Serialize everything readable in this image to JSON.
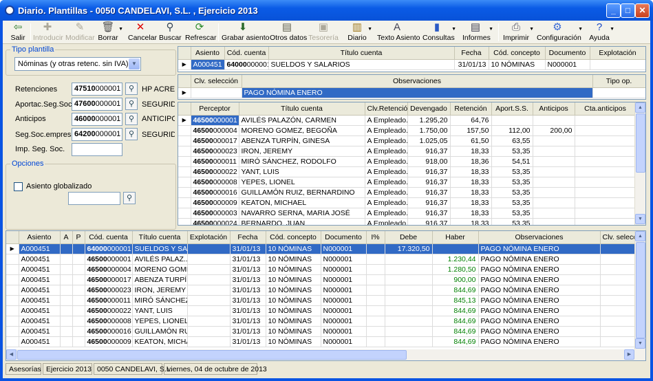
{
  "window": {
    "title": "Diario. Plantillas - 0050 CANDELAVI, S.L. , Ejercicio 2013"
  },
  "toolbar": {
    "salir": "Salir",
    "introducir": "Introducir",
    "modificar": "Modificar",
    "borrar": "Borrar",
    "cancelar": "Cancelar",
    "buscar": "Buscar",
    "refrescar": "Refrescar",
    "grabar_asiento": "Grabar asiento",
    "otros_datos": "Otros datos",
    "tesoreria": "Tesorería",
    "diario": "Diario",
    "texto_asiento": "Texto Asiento",
    "consultas": "Consultas",
    "informes": "Informes",
    "imprimir": "Imprimir",
    "configuracion": "Configuración",
    "ayuda": "Ayuda"
  },
  "left": {
    "tipo_title": "Tipo plantilla",
    "tipo_value": "Nóminas (y otras retenc. sin IVA)",
    "fields": [
      {
        "label": "Retenciones",
        "code_bold": "47510",
        "code": "000001",
        "desc": "HP ACREED"
      },
      {
        "label": "Aportac.Seg.Soc.",
        "code_bold": "47600",
        "code": "000001",
        "desc": "SEGURIDAI"
      },
      {
        "label": "Anticipos",
        "code_bold": "46000",
        "code": "000001",
        "desc": "ANTICIPOS"
      },
      {
        "label": "Seg.Soc.empresa",
        "code_bold": "64200",
        "code": "000001",
        "desc": "SEGURIDAI"
      },
      {
        "label": "Imp. Seg. Soc.",
        "code_bold": "",
        "code": "",
        "desc": ""
      }
    ],
    "opciones_title": "Opciones",
    "globalizado_label": "Asiento globalizado",
    "globalizado_value": ""
  },
  "header_grid": {
    "columns": [
      "Asiento",
      "Cód. cuenta",
      "Título cuenta",
      "Fecha",
      "Cód. concepto",
      "Documento",
      "Explotación"
    ],
    "row": {
      "asiento": "A000451",
      "cod_bold": "64000",
      "cod": "000001",
      "titulo": "SUELDOS Y SALARIOS",
      "fecha": "31/01/13",
      "concepto": "10 NÓMINAS",
      "documento": "N000001",
      "explotacion": ""
    }
  },
  "obs_grid": {
    "columns": [
      "Clv. selección",
      "Observaciones",
      "Tipo op."
    ],
    "row": {
      "clv": "",
      "obs": "PAGO NÓMINA ENERO",
      "tipo": ""
    }
  },
  "perceptor_grid": {
    "columns": [
      "Perceptor",
      "Título cuenta",
      "Clv.Retención",
      "Devengado",
      "Retención",
      "Aport.S.S.",
      "Anticipos",
      "Cta.anticipos"
    ],
    "rows": [
      [
        "46500",
        "000001",
        "AVILÉS PALAZÓN, CARMEN",
        "A Empleado...",
        "1.295,20",
        "64,76",
        "",
        "",
        ""
      ],
      [
        "46500",
        "000004",
        "MORENO GOMEZ, BEGOÑA",
        "A Empleado...",
        "1.750,00",
        "157,50",
        "112,00",
        "200,00",
        ""
      ],
      [
        "46500",
        "000017",
        "ABENZA TURPÍN, GINESA",
        "A Empleado...",
        "1.025,05",
        "61,50",
        "63,55",
        "",
        ""
      ],
      [
        "46500",
        "000023",
        "IRON, JEREMY",
        "A Empleado...",
        "916,37",
        "18,33",
        "53,35",
        "",
        ""
      ],
      [
        "46500",
        "000011",
        "MIRÓ SÁNCHEZ, RODOLFO",
        "A Empleado...",
        "918,00",
        "18,36",
        "54,51",
        "",
        ""
      ],
      [
        "46500",
        "000022",
        "YANT, LUIS",
        "A Empleado...",
        "916,37",
        "18,33",
        "53,35",
        "",
        ""
      ],
      [
        "46500",
        "000008",
        "YEPES, LIONEL",
        "A Empleado...",
        "916,37",
        "18,33",
        "53,35",
        "",
        ""
      ],
      [
        "46500",
        "000016",
        "GUILLAMÓN RUIZ, BERNARDINO",
        "A Empleado...",
        "916,37",
        "18,33",
        "53,35",
        "",
        ""
      ],
      [
        "46500",
        "000009",
        "KEATON, MICHAEL",
        "A Empleado...",
        "916,37",
        "18,33",
        "53,35",
        "",
        ""
      ],
      [
        "46500",
        "000003",
        "NAVARRO SERNA, MARIA JOSÉ",
        "A Empleado...",
        "916,37",
        "18,33",
        "53,35",
        "",
        ""
      ],
      [
        "46500",
        "000024",
        "BERNARDO, JUAN",
        "A Empleado...",
        "916,37",
        "18,33",
        "53,35",
        "",
        ""
      ]
    ]
  },
  "bottom_grid": {
    "columns": [
      "Asiento",
      "A",
      "P",
      "Cód. cuenta",
      "Título cuenta",
      "Explotación",
      "Fecha",
      "Cód. concepto",
      "Documento",
      "I%",
      "Debe",
      "Haber",
      "Observaciones",
      "Clv. selecc"
    ],
    "rows": [
      [
        "A000451",
        "64000",
        "000001",
        "SUELDOS Y SA...",
        "31/01/13",
        "10 NÓMINAS",
        "N000001",
        "17.320,50",
        "",
        "PAGO NÓMINA ENERO"
      ],
      [
        "A000451",
        "46500",
        "000001",
        "AVILÉS PALAZ...",
        "31/01/13",
        "10 NÓMINAS",
        "N000001",
        "",
        "1.230,44",
        "PAGO NÓMINA ENERO"
      ],
      [
        "A000451",
        "46500",
        "000004",
        "MORENO GOME...",
        "31/01/13",
        "10 NÓMINAS",
        "N000001",
        "",
        "1.280,50",
        "PAGO NÓMINA ENERO"
      ],
      [
        "A000451",
        "46500",
        "000017",
        "ABENZA TURPÍN...",
        "31/01/13",
        "10 NÓMINAS",
        "N000001",
        "",
        "900,00",
        "PAGO NÓMINA ENERO"
      ],
      [
        "A000451",
        "46500",
        "000023",
        "IRON, JEREMY",
        "31/01/13",
        "10 NÓMINAS",
        "N000001",
        "",
        "844,69",
        "PAGO NÓMINA ENERO"
      ],
      [
        "A000451",
        "46500",
        "000011",
        "MIRÓ SÁNCHEZ,...",
        "31/01/13",
        "10 NÓMINAS",
        "N000001",
        "",
        "845,13",
        "PAGO NÓMINA ENERO"
      ],
      [
        "A000451",
        "46500",
        "000022",
        "YANT, LUIS",
        "31/01/13",
        "10 NÓMINAS",
        "N000001",
        "",
        "844,69",
        "PAGO NÓMINA ENERO"
      ],
      [
        "A000451",
        "46500",
        "000008",
        "YEPES, LIONEL",
        "31/01/13",
        "10 NÓMINAS",
        "N000001",
        "",
        "844,69",
        "PAGO NÓMINA ENERO"
      ],
      [
        "A000451",
        "46500",
        "000016",
        "GUILLAMÓN RUI...",
        "31/01/13",
        "10 NÓMINAS",
        "N000001",
        "",
        "844,69",
        "PAGO NÓMINA ENERO"
      ],
      [
        "A000451",
        "46500",
        "000009",
        "KEATON, MICHA...",
        "31/01/13",
        "10 NÓMINAS",
        "N000001",
        "",
        "844,69",
        "PAGO NÓMINA ENERO"
      ]
    ]
  },
  "status": {
    "module": "Asesorías",
    "ejercicio": "Ejercicio 2013",
    "empresa": "0050 CANDELAVI, S.L.",
    "fecha": "viernes, 04 de octubre de 2013"
  },
  "colors": {
    "selection": "#316ac5",
    "title": "#0a5be6",
    "group_title": "#0046d5",
    "haber": "#008000"
  }
}
